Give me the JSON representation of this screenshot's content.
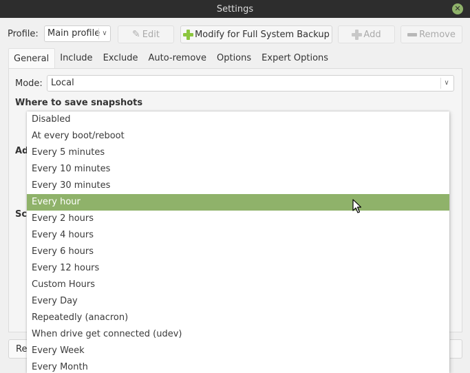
{
  "window": {
    "title": "Settings",
    "close_icon": "close-icon"
  },
  "toolbar": {
    "profile_label": "Profile:",
    "profile_value": "Main profile",
    "edit_label": "Edit",
    "modify_label": "Modify for Full System Backup",
    "add_label": "Add",
    "remove_label": "Remove"
  },
  "tabs": [
    {
      "label": "General",
      "active": true
    },
    {
      "label": "Include"
    },
    {
      "label": "Exclude"
    },
    {
      "label": "Auto-remove"
    },
    {
      "label": "Options"
    },
    {
      "label": "Expert Options"
    }
  ],
  "general": {
    "mode_label": "Mode:",
    "mode_value": "Local",
    "where_heading": "Where to save snapshots",
    "advanced_heading_partial": "Ad",
    "schedule_heading_partial": "Sc",
    "bottom_button_partial": "Re"
  },
  "schedule_dropdown": {
    "selected": "Every hour",
    "options": [
      "Disabled",
      "At every boot/reboot",
      "Every 5 minutes",
      "Every 10 minutes",
      "Every 30 minutes",
      "Every hour",
      "Every 2 hours",
      "Every 4 hours",
      "Every 6 hours",
      "Every 12 hours",
      "Custom Hours",
      "Every Day",
      "Repeatedly (anacron)",
      "When drive get connected (udev)",
      "Every Week",
      "Every Month"
    ]
  },
  "colors": {
    "accent": "#8fb26a",
    "titlebar": "#2d2d2d",
    "plus_icon": "#8cc63f"
  }
}
